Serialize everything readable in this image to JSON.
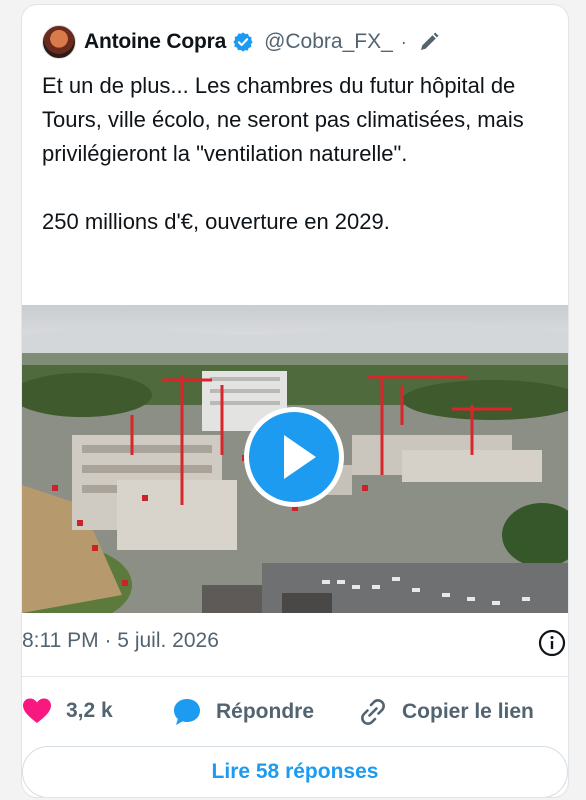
{
  "tweet": {
    "author_name": "Antoine Copra",
    "handle": "@Cobra_FX_",
    "separator": "·",
    "text": "Et un de plus... Les chambres du futur hôpital de Tours, ville écolo, ne seront pas climatisées, mais privilégieront la \"ventilation naturelle\".\n\n250 millions d'€, ouverture en 2029.",
    "timestamp": "8:11 PM · 5 juil. 2026"
  },
  "actions": {
    "likes_count": "3,2 k",
    "reply_label": "Répondre",
    "copy_link_label": "Copier le lien"
  },
  "read_replies_label": "Lire 58 réponses",
  "colors": {
    "accent": "#1d9bf0",
    "like": "#f91880",
    "muted": "#536471"
  },
  "icons": [
    "verified-badge-icon",
    "edit-pen-icon",
    "play-icon",
    "info-icon",
    "heart-icon",
    "reply-bubble-icon",
    "link-icon"
  ]
}
